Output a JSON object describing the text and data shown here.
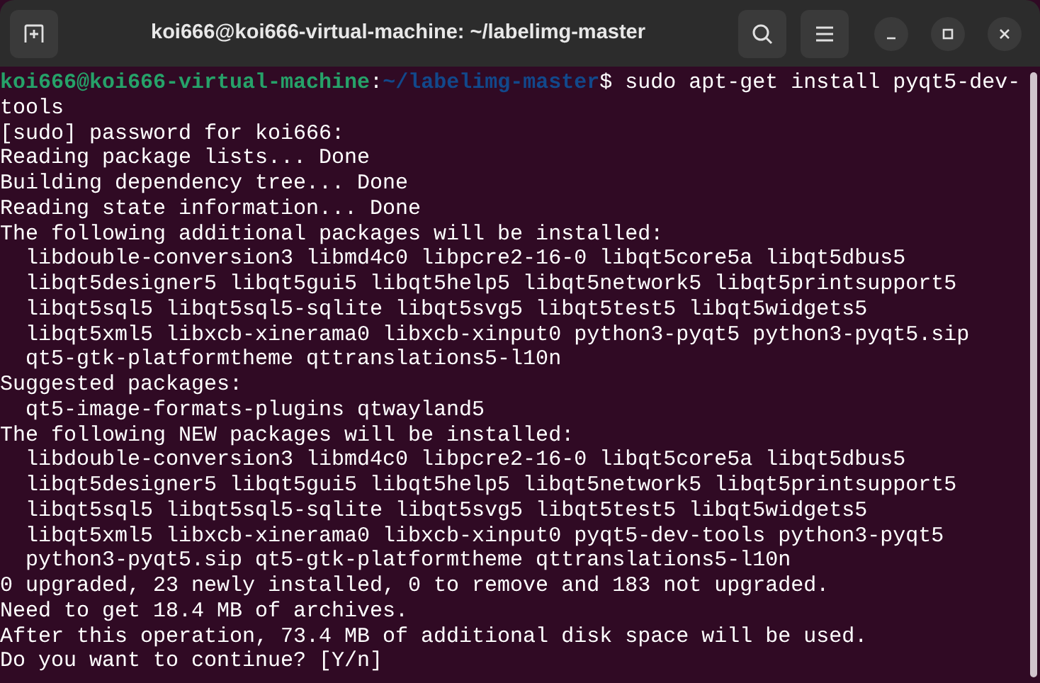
{
  "window": {
    "title": "koi666@koi666-virtual-machine: ~/labelimg-master"
  },
  "prompt": {
    "user_host": "koi666@koi666-virtual-machine",
    "separator": ":",
    "path": "~/labelimg-master",
    "symbol": "$",
    "command": " sudo apt-get install pyqt5-dev-tools"
  },
  "output_lines": [
    "[sudo] password for koi666:",
    "Reading package lists... Done",
    "Building dependency tree... Done",
    "Reading state information... Done",
    "The following additional packages will be installed:",
    "  libdouble-conversion3 libmd4c0 libpcre2-16-0 libqt5core5a libqt5dbus5",
    "  libqt5designer5 libqt5gui5 libqt5help5 libqt5network5 libqt5printsupport5",
    "  libqt5sql5 libqt5sql5-sqlite libqt5svg5 libqt5test5 libqt5widgets5",
    "  libqt5xml5 libxcb-xinerama0 libxcb-xinput0 python3-pyqt5 python3-pyqt5.sip",
    "  qt5-gtk-platformtheme qttranslations5-l10n",
    "Suggested packages:",
    "  qt5-image-formats-plugins qtwayland5",
    "The following NEW packages will be installed:",
    "  libdouble-conversion3 libmd4c0 libpcre2-16-0 libqt5core5a libqt5dbus5",
    "  libqt5designer5 libqt5gui5 libqt5help5 libqt5network5 libqt5printsupport5",
    "  libqt5sql5 libqt5sql5-sqlite libqt5svg5 libqt5test5 libqt5widgets5",
    "  libqt5xml5 libxcb-xinerama0 libxcb-xinput0 pyqt5-dev-tools python3-pyqt5",
    "  python3-pyqt5.sip qt5-gtk-platformtheme qttranslations5-l10n",
    "0 upgraded, 23 newly installed, 0 to remove and 183 not upgraded.",
    "Need to get 18.4 MB of archives.",
    "After this operation, 73.4 MB of additional disk space will be used.",
    "Do you want to continue? [Y/n]"
  ]
}
